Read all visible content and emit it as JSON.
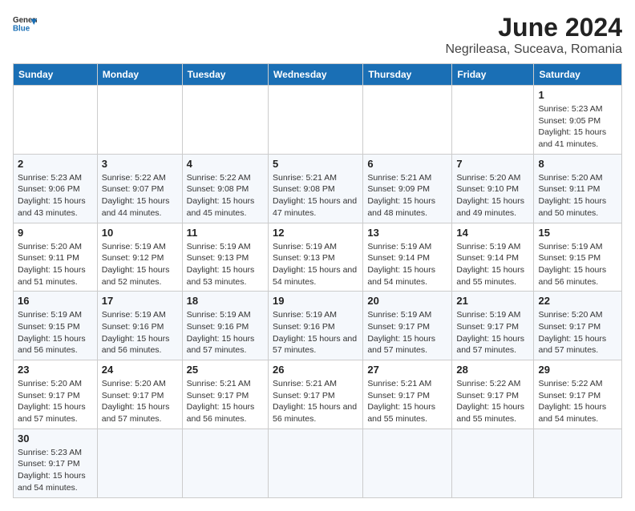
{
  "header": {
    "logo_line1": "General",
    "logo_line2": "Blue",
    "title": "June 2024",
    "subtitle": "Negrileasa, Suceava, Romania"
  },
  "weekdays": [
    "Sunday",
    "Monday",
    "Tuesday",
    "Wednesday",
    "Thursday",
    "Friday",
    "Saturday"
  ],
  "weeks": [
    [
      {
        "day": "",
        "sunrise": "",
        "sunset": "",
        "daylight": ""
      },
      {
        "day": "",
        "sunrise": "",
        "sunset": "",
        "daylight": ""
      },
      {
        "day": "",
        "sunrise": "",
        "sunset": "",
        "daylight": ""
      },
      {
        "day": "",
        "sunrise": "",
        "sunset": "",
        "daylight": ""
      },
      {
        "day": "",
        "sunrise": "",
        "sunset": "",
        "daylight": ""
      },
      {
        "day": "",
        "sunrise": "",
        "sunset": "",
        "daylight": ""
      },
      {
        "day": "1",
        "sunrise": "Sunrise: 5:23 AM",
        "sunset": "Sunset: 9:05 PM",
        "daylight": "Daylight: 15 hours and 41 minutes."
      }
    ],
    [
      {
        "day": "2",
        "sunrise": "Sunrise: 5:23 AM",
        "sunset": "Sunset: 9:06 PM",
        "daylight": "Daylight: 15 hours and 43 minutes."
      },
      {
        "day": "3",
        "sunrise": "Sunrise: 5:22 AM",
        "sunset": "Sunset: 9:07 PM",
        "daylight": "Daylight: 15 hours and 44 minutes."
      },
      {
        "day": "4",
        "sunrise": "Sunrise: 5:22 AM",
        "sunset": "Sunset: 9:08 PM",
        "daylight": "Daylight: 15 hours and 45 minutes."
      },
      {
        "day": "5",
        "sunrise": "Sunrise: 5:21 AM",
        "sunset": "Sunset: 9:08 PM",
        "daylight": "Daylight: 15 hours and 47 minutes."
      },
      {
        "day": "6",
        "sunrise": "Sunrise: 5:21 AM",
        "sunset": "Sunset: 9:09 PM",
        "daylight": "Daylight: 15 hours and 48 minutes."
      },
      {
        "day": "7",
        "sunrise": "Sunrise: 5:20 AM",
        "sunset": "Sunset: 9:10 PM",
        "daylight": "Daylight: 15 hours and 49 minutes."
      },
      {
        "day": "8",
        "sunrise": "Sunrise: 5:20 AM",
        "sunset": "Sunset: 9:11 PM",
        "daylight": "Daylight: 15 hours and 50 minutes."
      }
    ],
    [
      {
        "day": "9",
        "sunrise": "Sunrise: 5:20 AM",
        "sunset": "Sunset: 9:11 PM",
        "daylight": "Daylight: 15 hours and 51 minutes."
      },
      {
        "day": "10",
        "sunrise": "Sunrise: 5:19 AM",
        "sunset": "Sunset: 9:12 PM",
        "daylight": "Daylight: 15 hours and 52 minutes."
      },
      {
        "day": "11",
        "sunrise": "Sunrise: 5:19 AM",
        "sunset": "Sunset: 9:13 PM",
        "daylight": "Daylight: 15 hours and 53 minutes."
      },
      {
        "day": "12",
        "sunrise": "Sunrise: 5:19 AM",
        "sunset": "Sunset: 9:13 PM",
        "daylight": "Daylight: 15 hours and 54 minutes."
      },
      {
        "day": "13",
        "sunrise": "Sunrise: 5:19 AM",
        "sunset": "Sunset: 9:14 PM",
        "daylight": "Daylight: 15 hours and 54 minutes."
      },
      {
        "day": "14",
        "sunrise": "Sunrise: 5:19 AM",
        "sunset": "Sunset: 9:14 PM",
        "daylight": "Daylight: 15 hours and 55 minutes."
      },
      {
        "day": "15",
        "sunrise": "Sunrise: 5:19 AM",
        "sunset": "Sunset: 9:15 PM",
        "daylight": "Daylight: 15 hours and 56 minutes."
      }
    ],
    [
      {
        "day": "16",
        "sunrise": "Sunrise: 5:19 AM",
        "sunset": "Sunset: 9:15 PM",
        "daylight": "Daylight: 15 hours and 56 minutes."
      },
      {
        "day": "17",
        "sunrise": "Sunrise: 5:19 AM",
        "sunset": "Sunset: 9:16 PM",
        "daylight": "Daylight: 15 hours and 56 minutes."
      },
      {
        "day": "18",
        "sunrise": "Sunrise: 5:19 AM",
        "sunset": "Sunset: 9:16 PM",
        "daylight": "Daylight: 15 hours and 57 minutes."
      },
      {
        "day": "19",
        "sunrise": "Sunrise: 5:19 AM",
        "sunset": "Sunset: 9:16 PM",
        "daylight": "Daylight: 15 hours and 57 minutes."
      },
      {
        "day": "20",
        "sunrise": "Sunrise: 5:19 AM",
        "sunset": "Sunset: 9:17 PM",
        "daylight": "Daylight: 15 hours and 57 minutes."
      },
      {
        "day": "21",
        "sunrise": "Sunrise: 5:19 AM",
        "sunset": "Sunset: 9:17 PM",
        "daylight": "Daylight: 15 hours and 57 minutes."
      },
      {
        "day": "22",
        "sunrise": "Sunrise: 5:20 AM",
        "sunset": "Sunset: 9:17 PM",
        "daylight": "Daylight: 15 hours and 57 minutes."
      }
    ],
    [
      {
        "day": "23",
        "sunrise": "Sunrise: 5:20 AM",
        "sunset": "Sunset: 9:17 PM",
        "daylight": "Daylight: 15 hours and 57 minutes."
      },
      {
        "day": "24",
        "sunrise": "Sunrise: 5:20 AM",
        "sunset": "Sunset: 9:17 PM",
        "daylight": "Daylight: 15 hours and 57 minutes."
      },
      {
        "day": "25",
        "sunrise": "Sunrise: 5:21 AM",
        "sunset": "Sunset: 9:17 PM",
        "daylight": "Daylight: 15 hours and 56 minutes."
      },
      {
        "day": "26",
        "sunrise": "Sunrise: 5:21 AM",
        "sunset": "Sunset: 9:17 PM",
        "daylight": "Daylight: 15 hours and 56 minutes."
      },
      {
        "day": "27",
        "sunrise": "Sunrise: 5:21 AM",
        "sunset": "Sunset: 9:17 PM",
        "daylight": "Daylight: 15 hours and 55 minutes."
      },
      {
        "day": "28",
        "sunrise": "Sunrise: 5:22 AM",
        "sunset": "Sunset: 9:17 PM",
        "daylight": "Daylight: 15 hours and 55 minutes."
      },
      {
        "day": "29",
        "sunrise": "Sunrise: 5:22 AM",
        "sunset": "Sunset: 9:17 PM",
        "daylight": "Daylight: 15 hours and 54 minutes."
      }
    ],
    [
      {
        "day": "30",
        "sunrise": "Sunrise: 5:23 AM",
        "sunset": "Sunset: 9:17 PM",
        "daylight": "Daylight: 15 hours and 54 minutes."
      },
      {
        "day": "",
        "sunrise": "",
        "sunset": "",
        "daylight": ""
      },
      {
        "day": "",
        "sunrise": "",
        "sunset": "",
        "daylight": ""
      },
      {
        "day": "",
        "sunrise": "",
        "sunset": "",
        "daylight": ""
      },
      {
        "day": "",
        "sunrise": "",
        "sunset": "",
        "daylight": ""
      },
      {
        "day": "",
        "sunrise": "",
        "sunset": "",
        "daylight": ""
      },
      {
        "day": "",
        "sunrise": "",
        "sunset": "",
        "daylight": ""
      }
    ]
  ]
}
